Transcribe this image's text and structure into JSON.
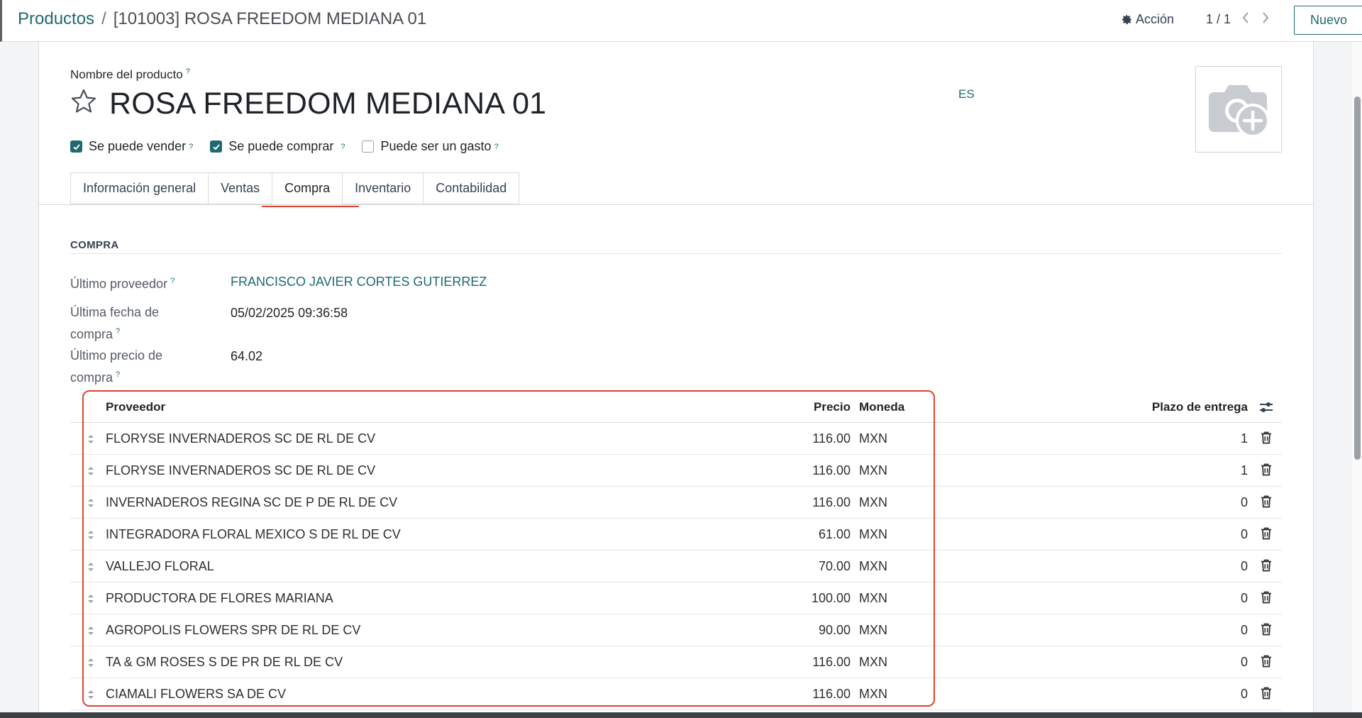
{
  "breadcrumb": {
    "parent": "Productos",
    "separator": "/",
    "current": "[101003] ROSA FREEDOM MEDIANA 01"
  },
  "controls": {
    "action_label": "Acción",
    "action_icon": "gear-icon",
    "pager": "1 / 1",
    "new_label": "Nuevo"
  },
  "product": {
    "name_label": "Nombre del producto",
    "help_mark": "?",
    "name": "ROSA FREEDOM MEDIANA 01",
    "lang": "ES",
    "favorite_icon": "star-icon",
    "photo_icon": "camera-plus-icon"
  },
  "checkboxes": [
    {
      "label": "Se puede vender",
      "checked": true
    },
    {
      "label": "Se puede comprar",
      "checked": true
    },
    {
      "label": "Puede ser un gasto",
      "checked": false
    }
  ],
  "tabs": [
    {
      "label": "Información general",
      "active": false
    },
    {
      "label": "Ventas",
      "active": false
    },
    {
      "label": "Compra",
      "active": true
    },
    {
      "label": "Inventario",
      "active": false
    },
    {
      "label": "Contabilidad",
      "active": false
    }
  ],
  "section": {
    "title": "COMPRA",
    "last_vendor_label": "Último proveedor",
    "last_vendor_value": "FRANCISCO JAVIER CORTES GUTIERREZ",
    "last_date_label_1": "Última fecha de",
    "last_date_label_2": "compra",
    "last_date_value": "05/02/2025 09:36:58",
    "last_price_label_1": "Último precio de",
    "last_price_label_2": "compra",
    "last_price_value": "64.02"
  },
  "vendor_table": {
    "headers": {
      "vendor": "Proveedor",
      "price": "Precio",
      "currency": "Moneda",
      "lead_time": "Plazo de entrega"
    },
    "rows": [
      {
        "vendor": "FLORYSE INVERNADEROS SC DE RL DE CV",
        "price": "116.00",
        "currency": "MXN",
        "lead_time": "1"
      },
      {
        "vendor": "FLORYSE INVERNADEROS SC DE RL DE CV",
        "price": "116.00",
        "currency": "MXN",
        "lead_time": "1"
      },
      {
        "vendor": "INVERNADEROS REGINA SC DE P DE RL DE CV",
        "price": "116.00",
        "currency": "MXN",
        "lead_time": "0"
      },
      {
        "vendor": "INTEGRADORA FLORAL MEXICO S DE RL DE CV",
        "price": "61.00",
        "currency": "MXN",
        "lead_time": "0"
      },
      {
        "vendor": "VALLEJO FLORAL",
        "price": "70.00",
        "currency": "MXN",
        "lead_time": "0"
      },
      {
        "vendor": "PRODUCTORA DE FLORES MARIANA",
        "price": "100.00",
        "currency": "MXN",
        "lead_time": "0"
      },
      {
        "vendor": "AGROPOLIS FLOWERS SPR DE RL DE CV",
        "price": "90.00",
        "currency": "MXN",
        "lead_time": "0"
      },
      {
        "vendor": "TA & GM ROSES S DE PR DE RL DE CV",
        "price": "116.00",
        "currency": "MXN",
        "lead_time": "0"
      },
      {
        "vendor": "CIAMALI FLOWERS SA DE CV",
        "price": "116.00",
        "currency": "MXN",
        "lead_time": "0"
      }
    ]
  },
  "colors": {
    "accent": "#1f6a6e",
    "highlight": "#e0432e"
  }
}
